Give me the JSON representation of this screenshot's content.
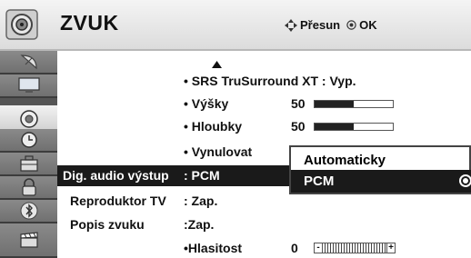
{
  "header": {
    "title": "ZVUK",
    "hint_move": "Přesun",
    "hint_ok": "OK"
  },
  "sidebar": {
    "items": [
      {
        "icon": "satellite-dish-icon"
      },
      {
        "icon": "monitor-icon"
      },
      {
        "icon": "speaker-icon",
        "active": true
      },
      {
        "icon": "clock-icon"
      },
      {
        "icon": "toolbox-icon"
      },
      {
        "icon": "lock-icon"
      },
      {
        "icon": "bluetooth-icon"
      },
      {
        "icon": "clapperboard-icon"
      }
    ]
  },
  "menu": {
    "srs": {
      "label": "• SRS TruSurround XT  : Vyp."
    },
    "treble": {
      "label": "• Výšky",
      "value": "50",
      "level": 50
    },
    "bass": {
      "label": "• Hloubky",
      "value": "50",
      "level": 50
    },
    "reset": {
      "label": "• Vynulovat"
    },
    "digital_audio": {
      "label": "Dig. audio výstup",
      "value": ": PCM"
    },
    "tv_speaker": {
      "label": "Reproduktor TV",
      "value": ": Zap."
    },
    "audio_description": {
      "label": "Popis zvuku",
      "value": ":Zap."
    },
    "volume": {
      "label": "•Hlasitost",
      "value": "0",
      "minus": "-",
      "plus": "+"
    }
  },
  "popup": {
    "options": [
      {
        "label": "Automaticky",
        "selected": false
      },
      {
        "label": "PCM",
        "selected": true
      }
    ]
  }
}
